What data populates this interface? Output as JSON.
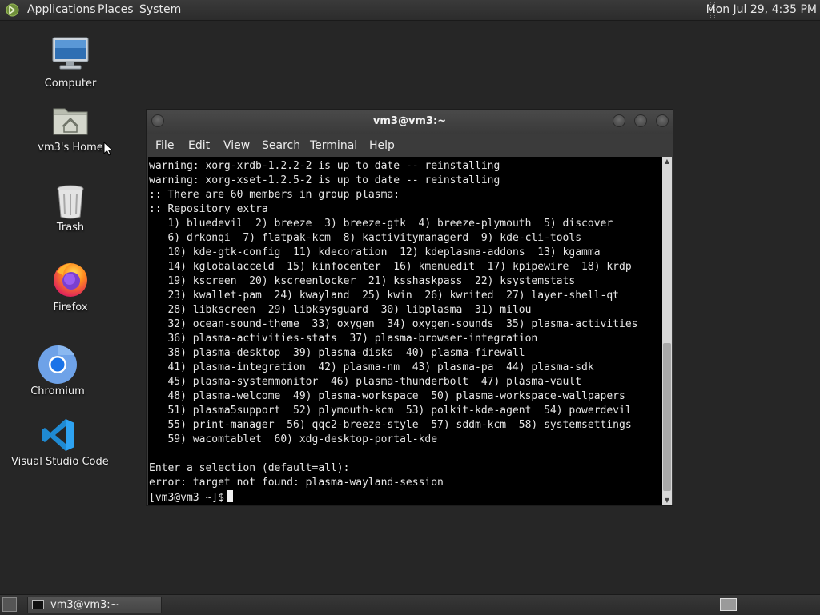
{
  "top_panel": {
    "menus": [
      "Applications",
      "Places",
      "System"
    ],
    "clock": "Mon Jul 29,  4:35 PM"
  },
  "desktop": {
    "icons": [
      {
        "label": "Computer",
        "icon": "computer-monitor-icon"
      },
      {
        "label": "vm3's Home",
        "icon": "home-folder-icon"
      },
      {
        "label": "Trash",
        "icon": "trash-icon"
      },
      {
        "label": "Firefox",
        "icon": "firefox-icon"
      },
      {
        "label": "Chromium",
        "icon": "chromium-icon"
      },
      {
        "label": "Visual Studio Code",
        "icon": "vscode-icon"
      }
    ]
  },
  "terminal": {
    "title": "vm3@vm3:~",
    "menu": [
      "File",
      "Edit",
      "View",
      "Search",
      "Terminal",
      "Help"
    ],
    "lines": [
      "warning: xorg-xrdb-1.2.2-2 is up to date -- reinstalling",
      "warning: xorg-xset-1.2.5-2 is up to date -- reinstalling",
      ":: There are 60 members in group plasma:",
      ":: Repository extra",
      "   1) bluedevil  2) breeze  3) breeze-gtk  4) breeze-plymouth  5) discover",
      "   6) drkonqi  7) flatpak-kcm  8) kactivitymanagerd  9) kde-cli-tools",
      "   10) kde-gtk-config  11) kdecoration  12) kdeplasma-addons  13) kgamma",
      "   14) kglobalacceld  15) kinfocenter  16) kmenuedit  17) kpipewire  18) krdp",
      "   19) kscreen  20) kscreenlocker  21) ksshaskpass  22) ksystemstats",
      "   23) kwallet-pam  24) kwayland  25) kwin  26) kwrited  27) layer-shell-qt",
      "   28) libkscreen  29) libksysguard  30) libplasma  31) milou",
      "   32) ocean-sound-theme  33) oxygen  34) oxygen-sounds  35) plasma-activities",
      "   36) plasma-activities-stats  37) plasma-browser-integration",
      "   38) plasma-desktop  39) plasma-disks  40) plasma-firewall",
      "   41) plasma-integration  42) plasma-nm  43) plasma-pa  44) plasma-sdk",
      "   45) plasma-systemmonitor  46) plasma-thunderbolt  47) plasma-vault",
      "   48) plasma-welcome  49) plasma-workspace  50) plasma-workspace-wallpapers",
      "   51) plasma5support  52) plymouth-kcm  53) polkit-kde-agent  54) powerdevil",
      "   55) print-manager  56) qqc2-breeze-style  57) sddm-kcm  58) systemsettings",
      "   59) wacomtablet  60) xdg-desktop-portal-kde",
      "",
      "Enter a selection (default=all):",
      "error: target not found: plasma-wayland-session"
    ],
    "prompt": "[vm3@vm3 ~]$"
  },
  "taskbar": {
    "task_label": "vm3@vm3:~"
  }
}
